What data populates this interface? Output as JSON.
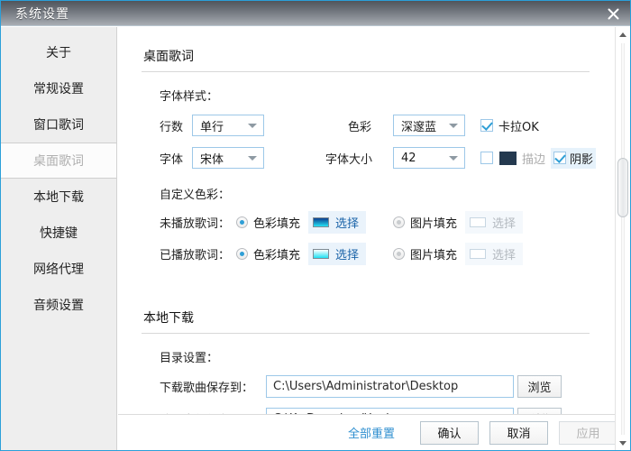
{
  "window": {
    "title": "系统设置",
    "close_icon": "close-icon",
    "accent": "#2b9fd9"
  },
  "sidebar": {
    "items": [
      {
        "label": "关于",
        "active": false
      },
      {
        "label": "常规设置",
        "active": false
      },
      {
        "label": "窗口歌词",
        "active": false
      },
      {
        "label": "桌面歌词",
        "active": true
      },
      {
        "label": "本地下载",
        "active": false
      },
      {
        "label": "快捷键",
        "active": false
      },
      {
        "label": "网络代理",
        "active": false
      },
      {
        "label": "音频设置",
        "active": false
      }
    ]
  },
  "desktop_lyric": {
    "section_title": "桌面歌词",
    "font_style_label": "字体样式：",
    "lines_label": "行数",
    "lines_value": "单行",
    "font_label": "字体",
    "font_value": "宋体",
    "color_label": "色彩",
    "color_value": "深邃蓝",
    "size_label": "字体大小",
    "size_value": "42",
    "karaoke_label": "卡拉OK",
    "karaoke_checked": true,
    "stroke_label": "描边",
    "stroke_checked": false,
    "stroke_color": "#24394f",
    "shadow_label": "阴影",
    "shadow_checked": true,
    "custom_color_label": "自定义色彩：",
    "rows": [
      {
        "label": "未播放歌词：",
        "fill_radio_label": "色彩填充",
        "fill_selected": true,
        "pick_label": "选择",
        "swatch_from": "#0a3d8f",
        "swatch_to": "#27e3f5",
        "image_radio_label": "图片填充",
        "image_selected": false,
        "image_pick_label": "选择"
      },
      {
        "label": "已播放歌词：",
        "fill_radio_label": "色彩填充",
        "fill_selected": true,
        "pick_label": "选择",
        "swatch_from": "#ffffff",
        "swatch_to": "#1fe0f2",
        "image_radio_label": "图片填充",
        "image_selected": false,
        "image_pick_label": "选择"
      }
    ]
  },
  "local_download": {
    "section_title": "本地下载",
    "dir_label": "目录设置：",
    "song_label": "下载歌曲保存到：",
    "song_path": "C:\\Users\\Administrator\\Desktop",
    "song_browse": "浏览",
    "lyric_label": "歌词文件保存到：",
    "lyric_path": "C:\\KwDownload\\Lyric",
    "lyric_browse": "浏览"
  },
  "footer": {
    "reset_label": "全部重置",
    "ok_label": "确认",
    "cancel_label": "取消",
    "apply_label": "应用",
    "apply_disabled": true
  },
  "scrollbar": {
    "up_icon": "chevron-up-icon",
    "down_icon": "chevron-down-icon"
  }
}
